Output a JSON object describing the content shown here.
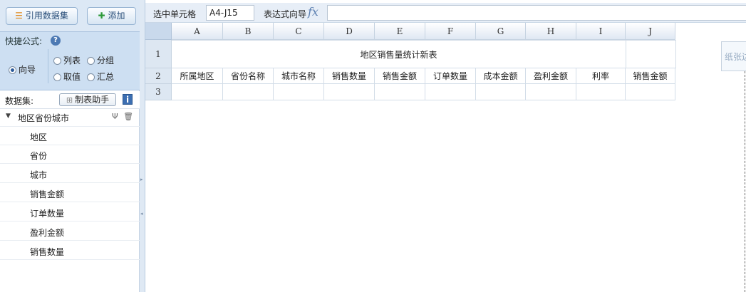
{
  "toolbar": {
    "ref_dataset_label": "引用数据集",
    "add_label": "添加"
  },
  "quick_formula": {
    "title": "快捷公式:",
    "help_icon": "?",
    "options": {
      "guide": "向导",
      "list": "列表",
      "group": "分组",
      "value": "取值",
      "summary": "汇总"
    },
    "selected": "向导"
  },
  "dataset": {
    "title": "数据集:",
    "helper_label": "制表助手",
    "info_icon": "i",
    "root": "地区省份城市",
    "fields": [
      "地区",
      "省份",
      "城市",
      "销售金额",
      "订单数量",
      "盈利金额",
      "销售数量"
    ]
  },
  "formula_bar": {
    "selected_cell_label": "选中单元格",
    "cell_ref": "A4-J15",
    "expr_wizard_label": "表达式向导",
    "fx": "fx",
    "formula": ""
  },
  "sheet": {
    "columns": [
      "A",
      "B",
      "C",
      "D",
      "E",
      "F",
      "G",
      "H",
      "I",
      "J"
    ],
    "rows": [
      "1",
      "2",
      "3"
    ],
    "title": "地区销售量统计新表",
    "headers": [
      "所属地区",
      "省份名称",
      "城市名称",
      "销售数量",
      "销售金额",
      "订单数量",
      "成本金额",
      "盈利金额",
      "利率",
      "销售金额"
    ]
  },
  "paper_hint": "纸张边",
  "colors": {
    "accent": "#3d6fb2",
    "panel_bg": "#cddff2",
    "header_bg": "#dfe8f3"
  }
}
